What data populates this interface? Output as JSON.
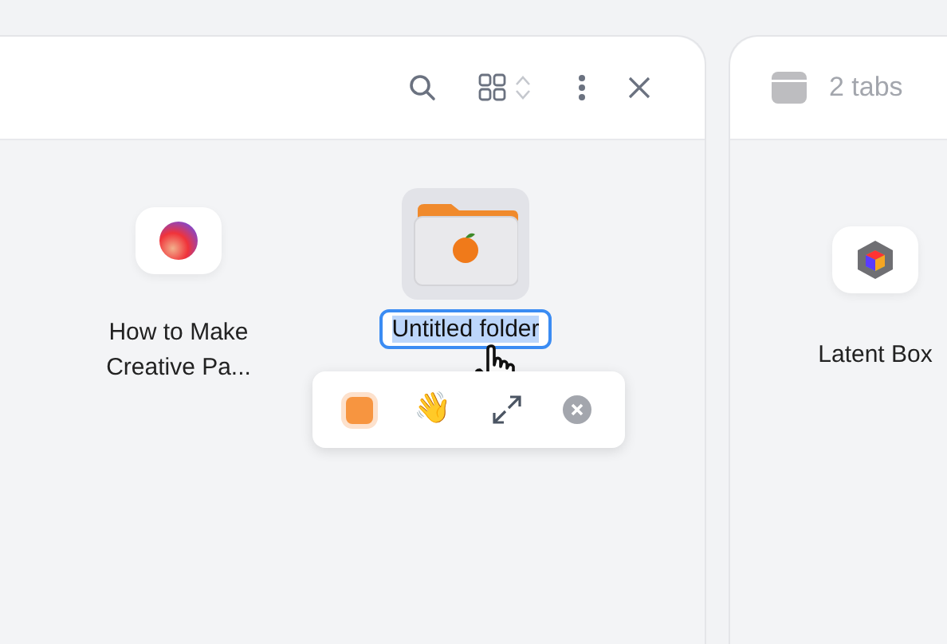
{
  "main_panel": {
    "items": [
      {
        "kind": "app",
        "label": "How to Make Creative Pa..."
      },
      {
        "kind": "folder",
        "label": "Untitled folder",
        "editing": true
      }
    ],
    "popup": [
      {
        "kind": "swatch",
        "color": "#f79540"
      },
      {
        "kind": "emoji",
        "text": "👋"
      },
      {
        "kind": "expand"
      },
      {
        "kind": "remove"
      }
    ]
  },
  "side_panel": {
    "title": "2 tabs",
    "items": [
      {
        "kind": "cube",
        "label": "Latent Box"
      }
    ]
  }
}
